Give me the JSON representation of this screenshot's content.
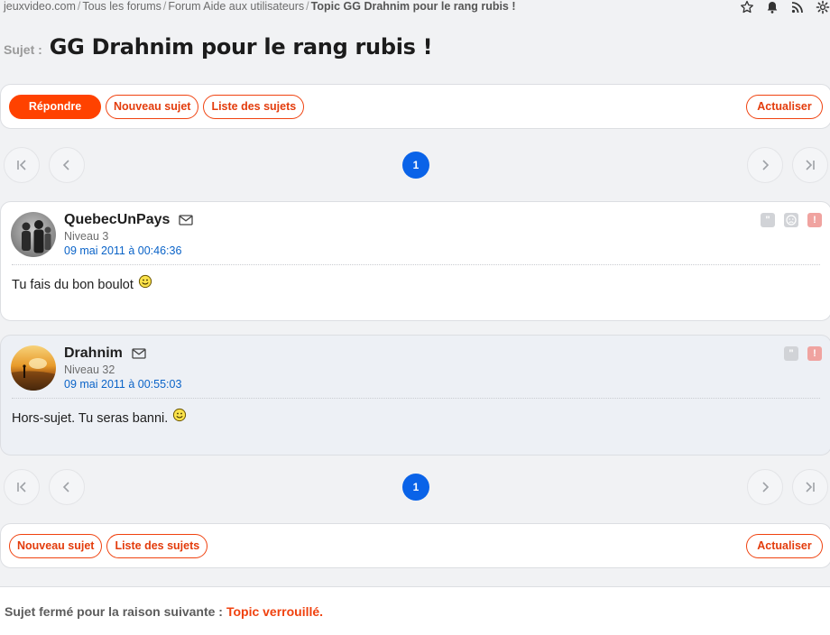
{
  "breadcrumb": {
    "items": [
      "jeuxvideo.com",
      "Tous les forums",
      "Forum Aide aux utilisateurs"
    ],
    "current": "Topic GG Drahnim pour le rang rubis !"
  },
  "top_icons": [
    "star-icon",
    "bell-icon",
    "rss-icon",
    "gear-icon"
  ],
  "topic": {
    "prefix": "Sujet :",
    "title": "GG Drahnim pour le rang rubis !"
  },
  "top_bar": {
    "reply": "Répondre",
    "new_topic": "Nouveau sujet",
    "topic_list": "Liste des sujets",
    "refresh": "Actualiser"
  },
  "pagination": {
    "current_page": "1"
  },
  "posts": [
    {
      "author": "QuebecUnPays",
      "level": "Niveau 3",
      "date": "09 mai 2011 à 00:46:36",
      "content": "Tu fais du bon boulot",
      "actions": [
        "quote-icon",
        "sad-icon",
        "alert-icon"
      ]
    },
    {
      "author": "Drahnim",
      "level": "Niveau 32",
      "date": "09 mai 2011 à 00:55:03",
      "content": "Hors-sujet. Tu seras banni.",
      "actions": [
        "quote-icon",
        "alert-icon"
      ]
    }
  ],
  "bottom_bar": {
    "new_topic": "Nouveau sujet",
    "topic_list": "Liste des sujets",
    "refresh": "Actualiser"
  },
  "closed_notice": {
    "label": "Sujet fermé pour la raison suivante :",
    "reason": "Topic verrouillé."
  },
  "colors": {
    "accent": "#ff4200",
    "page_active": "#0a63e8",
    "link_blue": "#0a63c8",
    "background": "#f1f2f4"
  }
}
